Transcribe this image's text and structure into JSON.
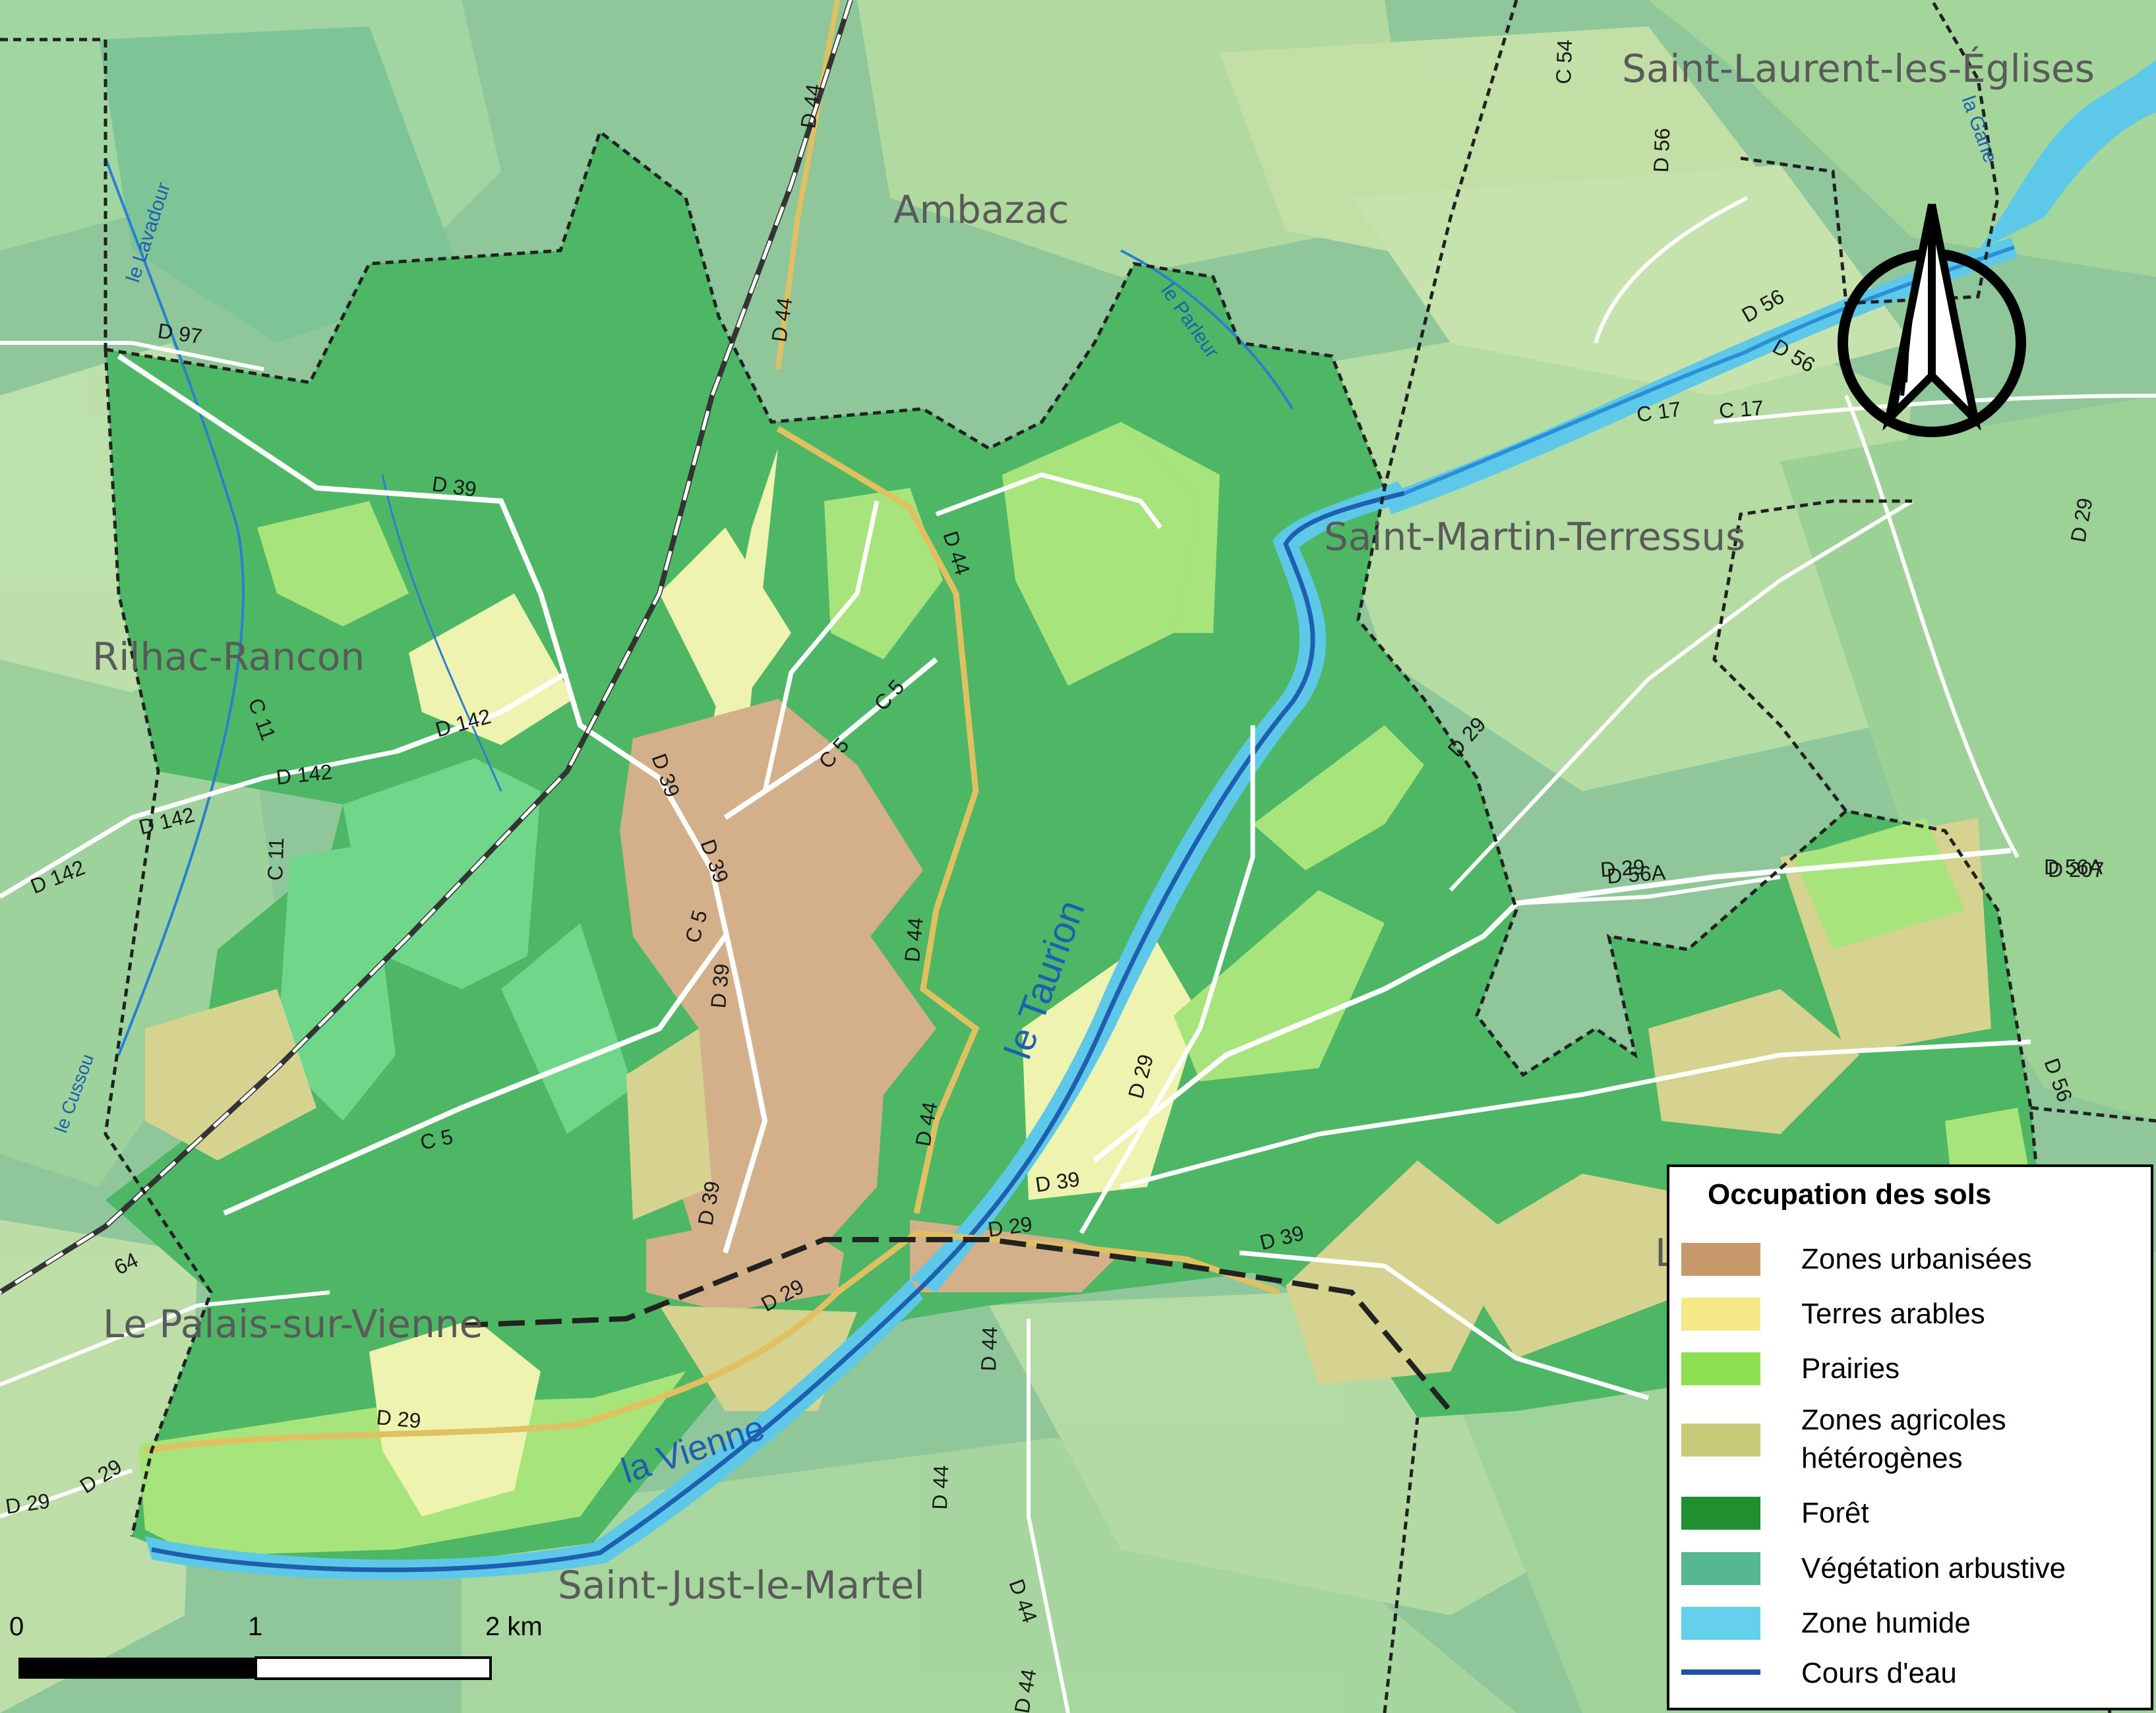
{
  "colors": {
    "background_forest": "#8fc79a",
    "urban": "#d4b08a",
    "arable": "#eef3b0",
    "meadow": "#a8e47c",
    "heterogeneous_agri": "#d5d38f",
    "forest": "#4db765",
    "shrub": "#6fd68a",
    "wetland": "#5ec8e8",
    "watercourse": "#1f5fb0",
    "road_main": "#e0c060",
    "road": "#ffffff"
  },
  "places": [
    {
      "id": "saint-laurent",
      "text": "Saint-Laurent-les-Églises"
    },
    {
      "id": "ambazac",
      "text": "Ambazac"
    },
    {
      "id": "saint-martin",
      "text": "Saint-Martin-Terressus"
    },
    {
      "id": "rilhac",
      "text": "Rilhac-Rancon"
    },
    {
      "id": "palais",
      "text": "Le Palais-sur-Vienne"
    },
    {
      "id": "saint-just",
      "text": "Saint-Just-le-Martel"
    },
    {
      "id": "l-partial",
      "text": "L"
    }
  ],
  "rivers": [
    {
      "id": "taurion",
      "text": "le Taurion"
    },
    {
      "id": "vienne",
      "text": "la Vienne"
    },
    {
      "id": "lavadour",
      "text": "le Lavadour"
    },
    {
      "id": "parleur",
      "text": "le Parleur"
    },
    {
      "id": "cussou",
      "text": "le Cussou"
    },
    {
      "id": "gane",
      "text": "la Gane"
    }
  ],
  "roads": [
    {
      "id": "d44-1",
      "text": "D 44"
    },
    {
      "id": "d44-2",
      "text": "D 44"
    },
    {
      "id": "d44-3",
      "text": "D 44"
    },
    {
      "id": "d44-4",
      "text": "D 44"
    },
    {
      "id": "d44-5",
      "text": "D 44"
    },
    {
      "id": "d44-6",
      "text": "D 44"
    },
    {
      "id": "d44-7",
      "text": "D 44"
    },
    {
      "id": "d44-8",
      "text": "D 44"
    },
    {
      "id": "d44-9",
      "text": "D 44"
    },
    {
      "id": "d97",
      "text": "D 97"
    },
    {
      "id": "d39-1",
      "text": "D 39"
    },
    {
      "id": "d39-2",
      "text": "D 39"
    },
    {
      "id": "d39-3",
      "text": "D 39"
    },
    {
      "id": "d39-4",
      "text": "D 39"
    },
    {
      "id": "d39-5",
      "text": "D 39"
    },
    {
      "id": "d39-6",
      "text": "D 39"
    },
    {
      "id": "d39-7",
      "text": "D 39"
    },
    {
      "id": "d142-1",
      "text": "D 142"
    },
    {
      "id": "d142-2",
      "text": "D 142"
    },
    {
      "id": "d142-3",
      "text": "D 142"
    },
    {
      "id": "d142-4",
      "text": "D 142"
    },
    {
      "id": "c11-1",
      "text": "C 11"
    },
    {
      "id": "c11-2",
      "text": "C 11"
    },
    {
      "id": "c5-1",
      "text": "C 5"
    },
    {
      "id": "c5-2",
      "text": "C 5"
    },
    {
      "id": "c5-3",
      "text": "C 5"
    },
    {
      "id": "c5-4",
      "text": "C 5"
    },
    {
      "id": "c54",
      "text": "C 54"
    },
    {
      "id": "d56-1",
      "text": "D 56"
    },
    {
      "id": "d56-2",
      "text": "D 56"
    },
    {
      "id": "d56-3",
      "text": "D 56"
    },
    {
      "id": "d56-4",
      "text": "D 56"
    },
    {
      "id": "c17-1",
      "text": "C 17"
    },
    {
      "id": "c17-2",
      "text": "C 17"
    },
    {
      "id": "d29-1",
      "text": "D 29"
    },
    {
      "id": "d29-2",
      "text": "D 29"
    },
    {
      "id": "d29-3",
      "text": "D 29"
    },
    {
      "id": "d29-4",
      "text": "D 29"
    },
    {
      "id": "d29-5",
      "text": "D 29"
    },
    {
      "id": "d29-6",
      "text": "D 29"
    },
    {
      "id": "d29-7",
      "text": "D 29"
    },
    {
      "id": "d29-8",
      "text": "D 29"
    },
    {
      "id": "d29-9",
      "text": "D 29"
    },
    {
      "id": "d56a-1",
      "text": "D 56A"
    },
    {
      "id": "d56a-2",
      "text": "D 56A"
    },
    {
      "id": "d207",
      "text": "D 207"
    },
    {
      "id": "r64",
      "text": "64"
    }
  ],
  "legend": {
    "title": "Occupation des sols",
    "items": [
      {
        "label": "Zones urbanisées",
        "color": "#c8996a",
        "kind": "fill"
      },
      {
        "label": "Terres arables",
        "color": "#f5e887",
        "kind": "fill"
      },
      {
        "label": "Prairies",
        "color": "#8fe050",
        "kind": "fill"
      },
      {
        "label": "Zones agricoles hétérogènes",
        "line1": "Zones agricoles",
        "line2": "hétérogènes",
        "color": "#c9c97a",
        "kind": "fill"
      },
      {
        "label": "Forêt",
        "color": "#1f8f2f",
        "kind": "fill"
      },
      {
        "label": "Végétation arbustive",
        "color": "#55b890",
        "kind": "fill"
      },
      {
        "label": "Zone humide",
        "color": "#65d0ec",
        "kind": "fill"
      },
      {
        "label": "Cours d'eau",
        "color": "#1f4fa8",
        "kind": "line"
      }
    ]
  },
  "scale": {
    "labels": [
      "0",
      "1",
      "2 km"
    ]
  },
  "north_arrow": {
    "icon": "north-arrow-icon"
  }
}
